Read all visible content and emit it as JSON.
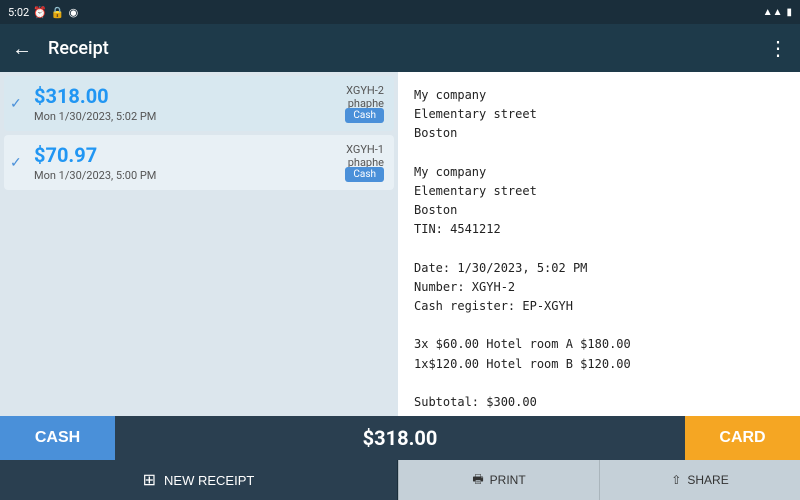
{
  "statusBar": {
    "time": "5:02",
    "icons": [
      "alarm",
      "lock",
      "signal"
    ]
  },
  "toolbar": {
    "title": "Receipt",
    "backLabel": "←",
    "moreLabel": "⋮"
  },
  "receiptList": {
    "items": [
      {
        "amount": "$318.00",
        "date": "Mon 1/30/2023, 5:02 PM",
        "id": "XGYH-2",
        "user": "phaphe",
        "paymentType": "Cash",
        "selected": true
      },
      {
        "amount": "$70.97",
        "date": "Mon 1/30/2023, 5:00 PM",
        "id": "XGYH-1",
        "user": "phaphe",
        "paymentType": "Cash",
        "selected": false
      }
    ]
  },
  "receiptDetail": {
    "lines": [
      "My company",
      "Elementary street",
      "Boston",
      "",
      "My company",
      "Elementary street",
      "Boston",
      "TIN: 4541212",
      "",
      "Date: 1/30/2023, 5:02 PM",
      "Number: XGYH-2",
      "Cash register: EP-XGYH",
      "",
      "3x $60.00 Hotel room A $180.00",
      "1x$120.00 Hotel room B $120.00",
      "",
      "Subtotal: $300.00"
    ]
  },
  "actionBar": {
    "cashLabel": "CASH",
    "amount": "$318.00",
    "cardLabel": "CARD"
  },
  "bottomBar": {
    "newReceiptLabel": "NEW RECEIPT",
    "printLabel": "PRINT",
    "shareLabel": "SHARE"
  }
}
